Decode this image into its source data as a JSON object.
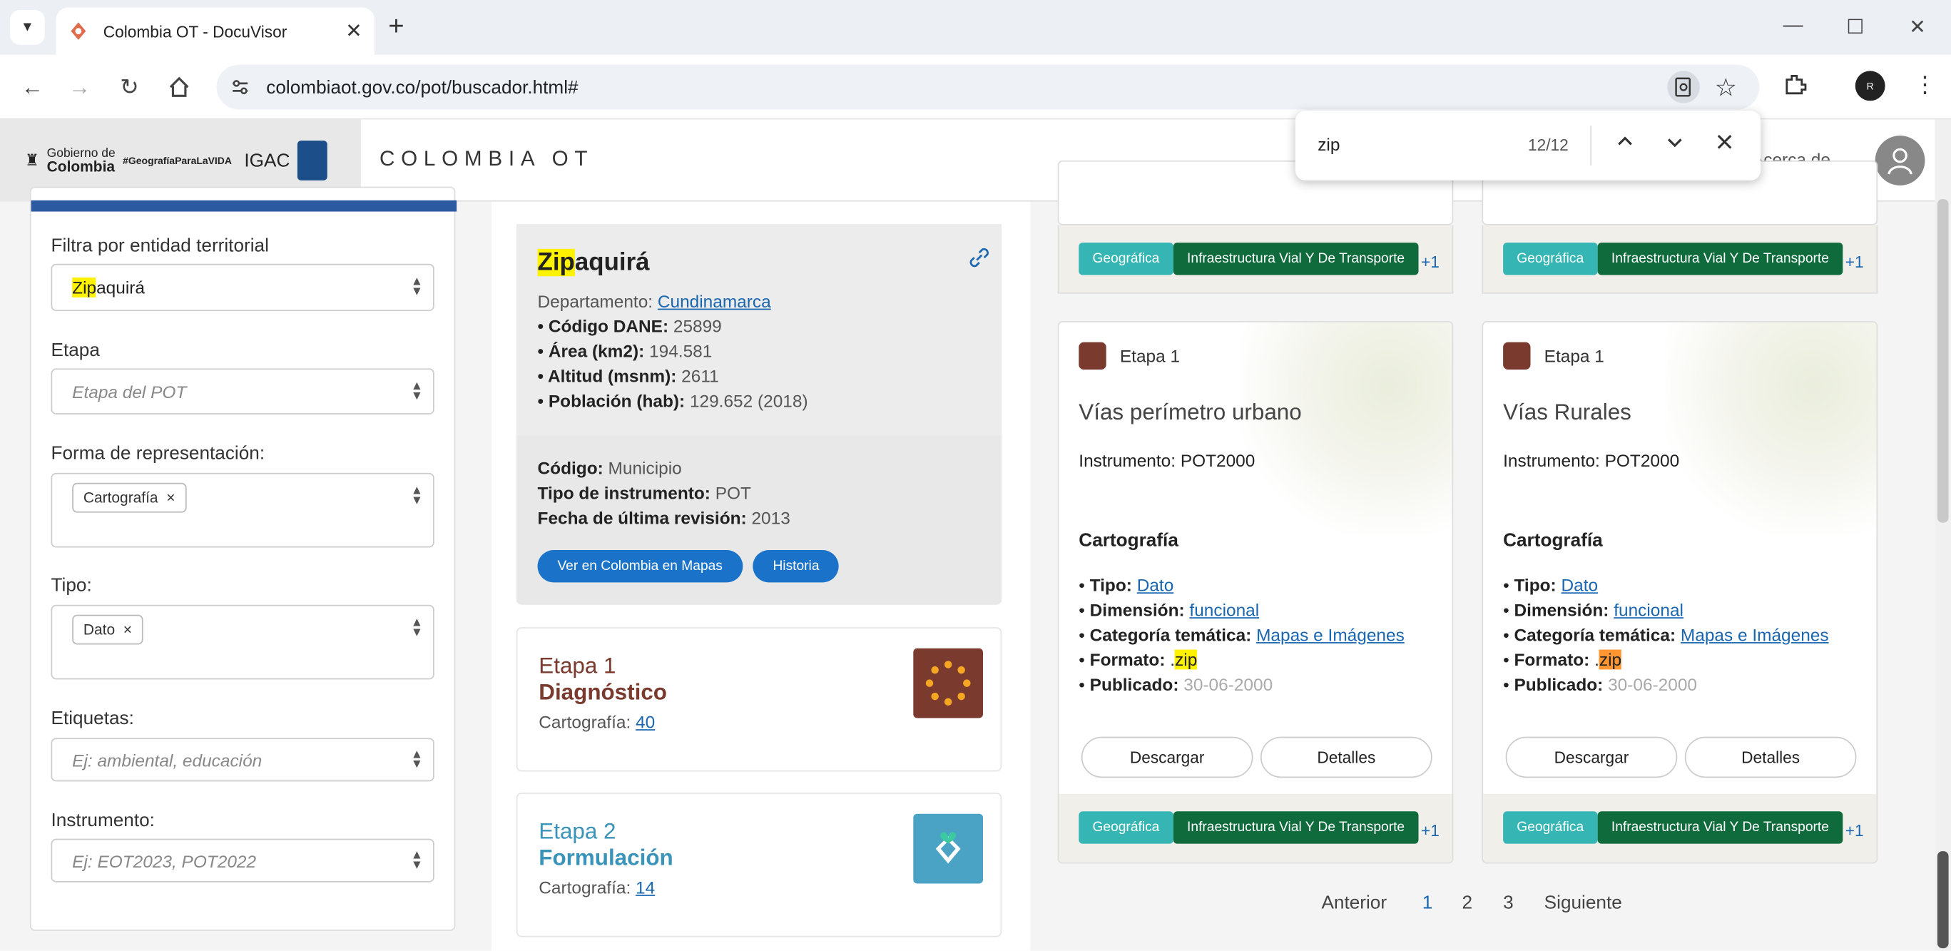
{
  "browser": {
    "tab_title": "Colombia OT - DocuVisor",
    "url": "colombiaot.gov.co/pot/buscador.html#",
    "new_tab": "+",
    "profile": "R"
  },
  "header": {
    "gov_line1": "Gobierno de",
    "gov_line2": "Colombia",
    "slogan": "#GeografíaParaLaVIDA",
    "igac": "IGAC",
    "brand": "COLOMBIA OT",
    "about": "Acerca de"
  },
  "find": {
    "query": "zip",
    "count": "12/12"
  },
  "filters": {
    "entity_label": "Filtra por entidad territorial",
    "entity_hl": "Zip",
    "entity_rest": "aquirá",
    "stage_label": "Etapa",
    "stage_placeholder": "Etapa del POT",
    "rep_label": "Forma de representación:",
    "rep_chip": "Cartografía",
    "type_label": "Tipo:",
    "type_chip": "Dato",
    "chip_remove": "×",
    "tags_label": "Etiquetas:",
    "tags_placeholder": "Ej: ambiental, educación",
    "instr_label": "Instrumento:",
    "instr_placeholder": "Ej: EOT2023, POT2022"
  },
  "municipio": {
    "name_hl": "Zip",
    "name_rest": "aquirá",
    "dept_label": "Departamento:",
    "dept": "Cundinamarca",
    "dane_label": "• Código DANE:",
    "dane": "25899",
    "area_label": "• Área (km2):",
    "area": "194.581",
    "alt_label": "• Altitud (msnm):",
    "alt": "2611",
    "pop_label": "• Población (hab):",
    "pop": "129.652 (2018)",
    "code_label": "Código:",
    "code": "Municipio",
    "instr_label": "Tipo de instrumento:",
    "instr": "POT",
    "rev_label": "Fecha de última revisión:",
    "rev": "2013",
    "btn_maps": "Ver en Colombia en Mapas",
    "btn_hist": "Historia"
  },
  "etapas": [
    {
      "num": "Etapa 1",
      "name": "Diagnóstico",
      "label": "Cartografía:",
      "count": "40",
      "color": "#7a3b2e"
    },
    {
      "num": "Etapa 2",
      "name": "Formulación",
      "label": "Cartografía:",
      "count": "14",
      "color": "#3a93b8"
    }
  ],
  "tags": {
    "geo": "Geográfica",
    "infra": "Infraestructura Vial Y De Transporte",
    "more": "+1"
  },
  "cards": [
    {
      "stage": "Etapa 1",
      "title": "Vías perímetro urbano",
      "instr": "Instrumento: POT2000",
      "section": "Cartografía",
      "tipo_l": "Tipo:",
      "tipo": "Dato",
      "dim_l": "Dimensión:",
      "dim": "funcional",
      "cat_l": "Categoría temática:",
      "cat": "Mapas e Imágenes",
      "fmt_l": "Formato:",
      "fmt_pre": ".",
      "fmt": "zip",
      "pub_l": "Publicado:",
      "pub": "30-06-2000",
      "download": "Descargar",
      "details": "Detalles"
    },
    {
      "stage": "Etapa 1",
      "title": "Vías Rurales",
      "instr": "Instrumento: POT2000",
      "section": "Cartografía",
      "tipo_l": "Tipo:",
      "tipo": "Dato",
      "dim_l": "Dimensión:",
      "dim": "funcional",
      "cat_l": "Categoría temática:",
      "cat": "Mapas e Imágenes",
      "fmt_l": "Formato:",
      "fmt_pre": ".",
      "fmt": "zip",
      "pub_l": "Publicado:",
      "pub": "30-06-2000",
      "download": "Descargar",
      "details": "Detalles"
    }
  ],
  "pager": {
    "prev": "Anterior",
    "p1": "1",
    "p2": "2",
    "p3": "3",
    "next": "Siguiente"
  }
}
